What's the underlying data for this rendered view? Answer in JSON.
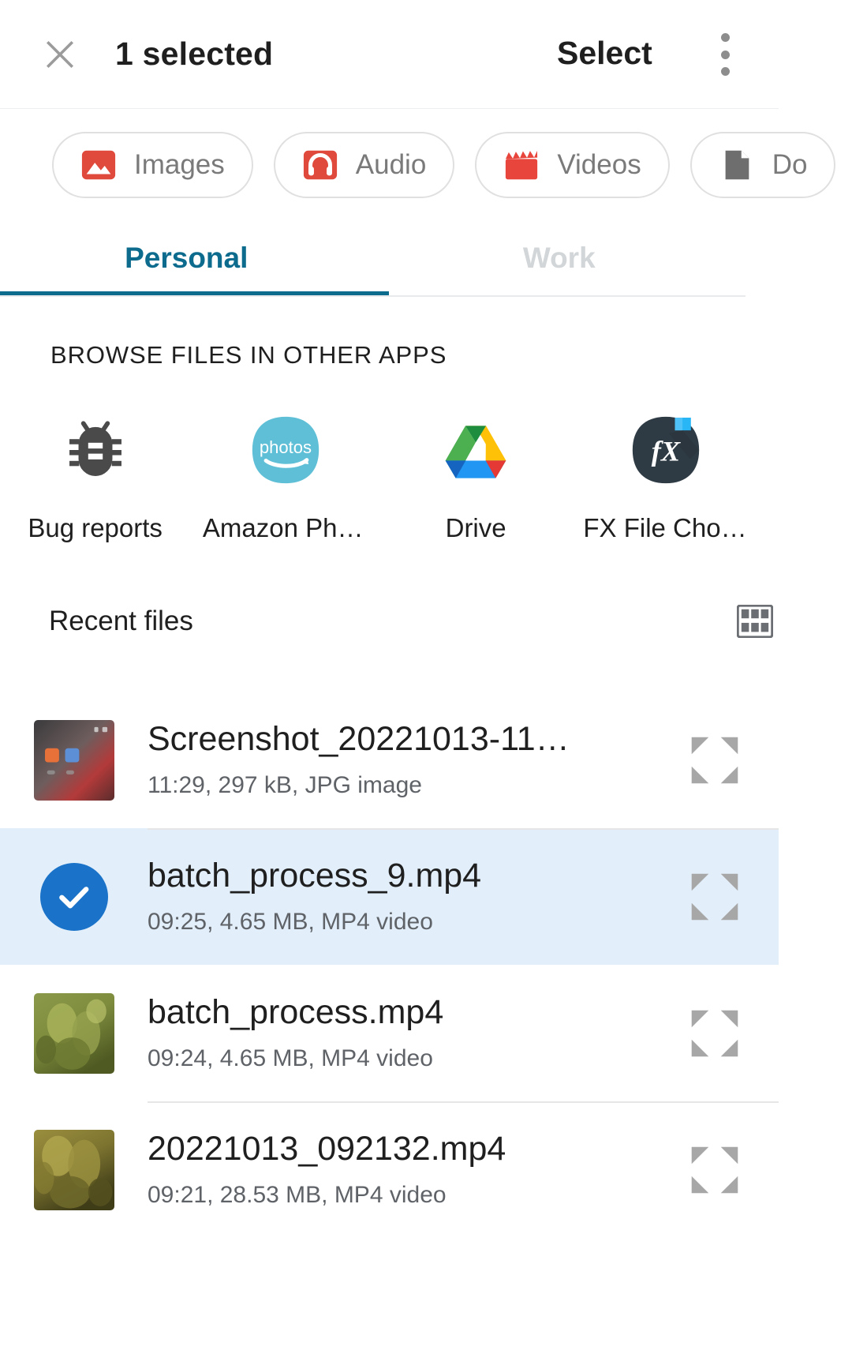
{
  "appbar": {
    "close_icon": "close-icon",
    "title": "1 selected",
    "action_label": "Select",
    "overflow_icon": "overflow-menu-icon"
  },
  "filter_chips": [
    {
      "label": "Images",
      "icon": "image-icon",
      "color": "#E04A3C"
    },
    {
      "label": "Audio",
      "icon": "headphones-icon",
      "color": "#E04A3C"
    },
    {
      "label": "Videos",
      "icon": "movie-clapper-icon",
      "color": "#E8453C"
    },
    {
      "label": "Do",
      "icon": "document-icon",
      "color": "#6E6E6E"
    }
  ],
  "tabs": [
    {
      "label": "Personal",
      "active": true
    },
    {
      "label": "Work",
      "active": false
    }
  ],
  "browse": {
    "header": "BROWSE FILES IN OTHER APPS",
    "apps": [
      {
        "label": "Bug reports",
        "icon": "bug-icon"
      },
      {
        "label": "Amazon Pho…",
        "icon": "amazon-photos-icon"
      },
      {
        "label": "Drive",
        "icon": "google-drive-icon"
      },
      {
        "label": "FX File Choo…",
        "icon": "fx-file-explorer-icon"
      }
    ]
  },
  "recent": {
    "title": "Recent files",
    "view_toggle_icon": "grid-view-icon"
  },
  "files": [
    {
      "name": "Screenshot_20221013-11…",
      "meta": "11:29, 297 kB, JPG image",
      "selected": false,
      "thumb": "screenshot-thumbnail",
      "expand_icon": "expand-icon"
    },
    {
      "name": "batch_process_9.mp4",
      "meta": "09:25, 4.65 MB, MP4 video",
      "selected": true,
      "thumb": "selected-checkmark",
      "expand_icon": "expand-icon"
    },
    {
      "name": "batch_process.mp4",
      "meta": "09:24, 4.65 MB, MP4 video",
      "selected": false,
      "thumb": "plant-thumbnail",
      "expand_icon": "expand-icon"
    },
    {
      "name": "20221013_092132.mp4",
      "meta": "09:21, 28.53 MB, MP4 video",
      "selected": false,
      "thumb": "plant-thumbnail",
      "expand_icon": "expand-icon"
    }
  ],
  "colors": {
    "accent_tab": "#0D6B8E",
    "selection_blue": "#1A73C8",
    "selected_row_bg": "#E2EFFB",
    "chip_red": "#E8453C"
  }
}
